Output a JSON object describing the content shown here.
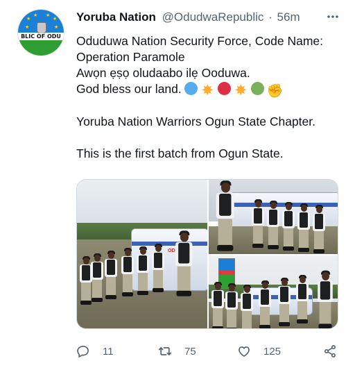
{
  "tweet": {
    "author": {
      "name": "Yoruba Nation",
      "handle": "@OdudwaRepublic",
      "separator": "·",
      "time": "56m",
      "avatar_text": "BLIC OF ODU"
    },
    "body": {
      "lines": [
        "Oduduwa Nation Security Force, Code Name:",
        "Operation Paramole",
        "Awọn ẹṣọ oludaabo ilẹ Ooduwa.",
        "God bless our land."
      ],
      "emojis": [
        "blue-circle",
        "sun",
        "red-circle",
        "sun",
        "green-circle",
        "raised-fist"
      ],
      "paragraph_2": "Yoruba Nation Warriors Ogun State Chapter.",
      "paragraph_3": "This is the first batch from Ogun State."
    },
    "media": {
      "photo_count": 3,
      "bus_logo_text": "ODEDE"
    },
    "actions": {
      "reply_count": "11",
      "retweet_count": "75",
      "like_count": "125"
    },
    "colors": {
      "text": "#0f1419",
      "secondary": "#536471",
      "border": "#cfd9de"
    }
  }
}
